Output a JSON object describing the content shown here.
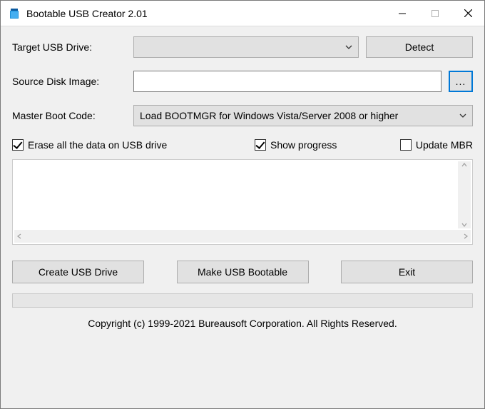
{
  "window": {
    "title": "Bootable USB Creator 2.01"
  },
  "labels": {
    "target_drive": "Target USB Drive:",
    "source_image": "Source Disk Image:",
    "master_boot": "Master Boot Code:"
  },
  "buttons": {
    "detect": "Detect",
    "browse": "...",
    "create": "Create USB Drive",
    "make_bootable": "Make USB Bootable",
    "exit": "Exit"
  },
  "fields": {
    "target_drive_value": "",
    "source_image_value": "",
    "master_boot_value": "Load BOOTMGR for Windows Vista/Server 2008 or higher"
  },
  "checks": {
    "erase": {
      "label": "Erase all the data on USB drive",
      "checked": true
    },
    "show_progress": {
      "label": "Show progress",
      "checked": true
    },
    "update_mbr": {
      "label": "Update MBR",
      "checked": false
    }
  },
  "footer": "Copyright (c) 1999-2021 Bureausoft Corporation. All Rights Reserved."
}
